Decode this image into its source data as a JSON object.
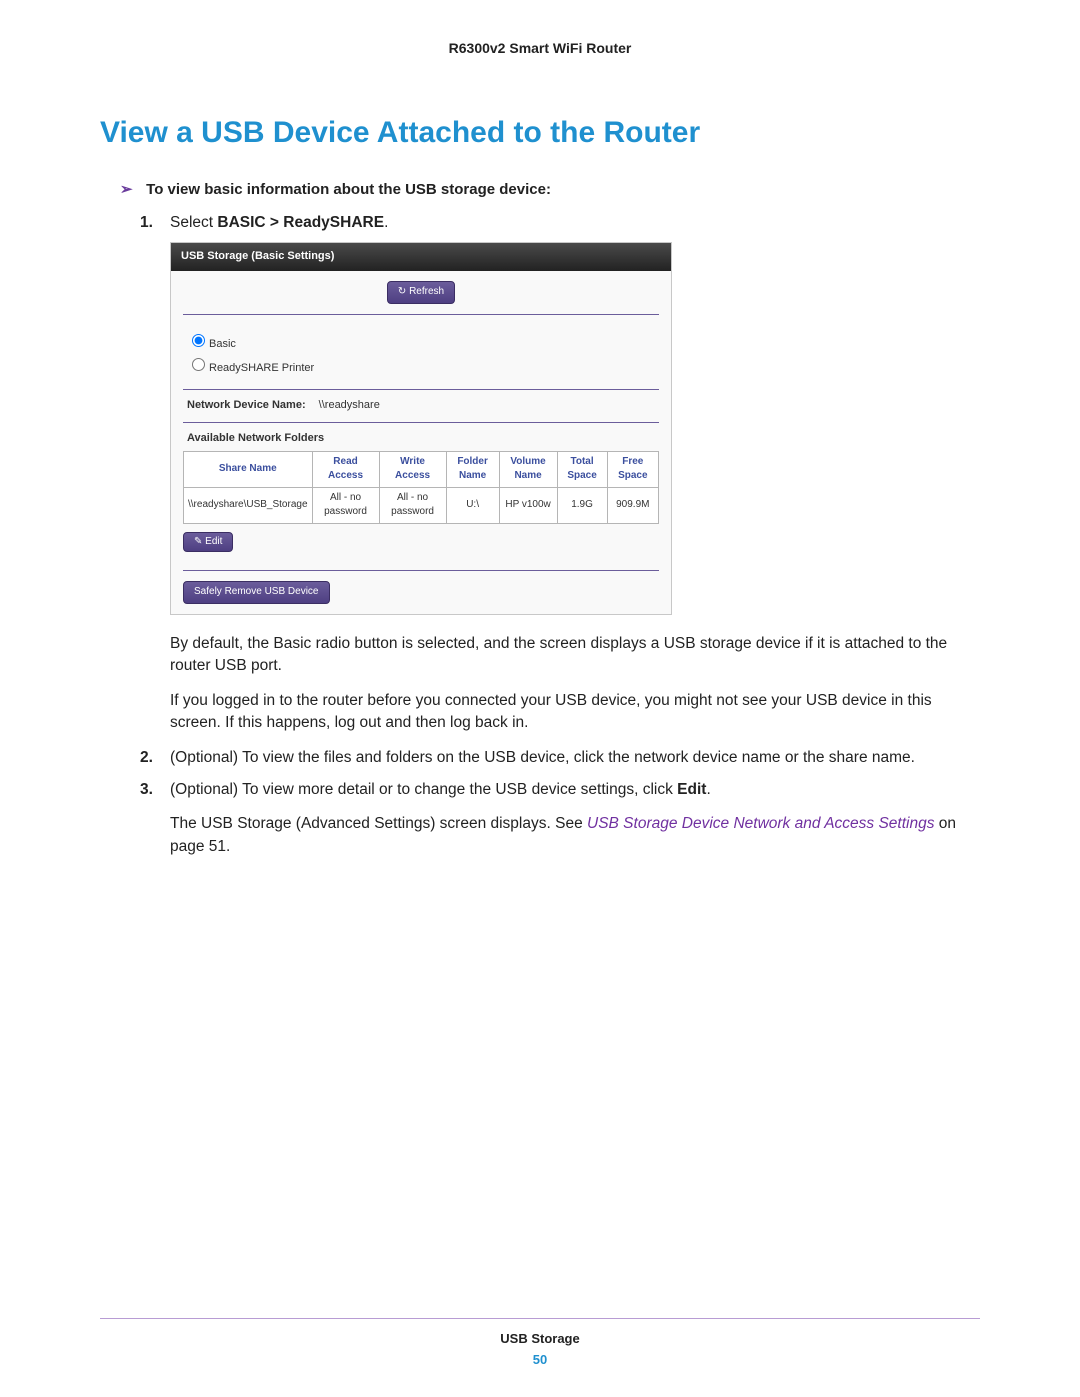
{
  "doc_header": "R6300v2 Smart WiFi Router",
  "section_title": "View a USB Device Attached to the Router",
  "task_intro": "To view basic information about the USB storage device:",
  "steps": {
    "s1": {
      "text_prefix": "Select ",
      "nav_path": "BASIC > ReadySHARE",
      "text_suffix": ".",
      "followup_a": "By default, the Basic radio button is selected, and the screen displays a USB storage device if it is attached to the router USB port.",
      "followup_b": "If you logged in to the router before you connected your USB device, you might not see your USB device in this screen. If this happens, log out and then log back in."
    },
    "s2": "(Optional) To view the files and folders on the USB device, click the network device name or the share name.",
    "s3": {
      "a": "(Optional) To view more detail or to change the USB device settings, click ",
      "b_bold": "Edit",
      "c": ".",
      "follow_prefix": "The USB Storage (Advanced Settings) screen displays. See ",
      "follow_link": "USB Storage Device Network and Access Settings",
      "follow_suffix": " on page 51."
    }
  },
  "panel": {
    "title": "USB Storage (Basic Settings)",
    "refresh_label": "Refresh",
    "radio_basic": "Basic",
    "radio_printer": "ReadySHARE Printer",
    "ndn_label": "Network Device Name:",
    "ndn_value": "\\\\readyshare",
    "folders_title": "Available Network Folders",
    "headers": {
      "share": "Share Name",
      "read": "Read Access",
      "write": "Write Access",
      "folder": "Folder Name",
      "volume": "Volume Name",
      "total": "Total Space",
      "free": "Free Space"
    },
    "row": {
      "share": "\\\\readyshare\\USB_Storage",
      "read": "All - no password",
      "write": "All - no password",
      "folder": "U:\\",
      "volume": "HP v100w",
      "total": "1.9G",
      "free": "909.9M"
    },
    "edit_label": "Edit",
    "safely_label": "Safely Remove USB Device"
  },
  "footer": {
    "title": "USB Storage",
    "page": "50"
  }
}
